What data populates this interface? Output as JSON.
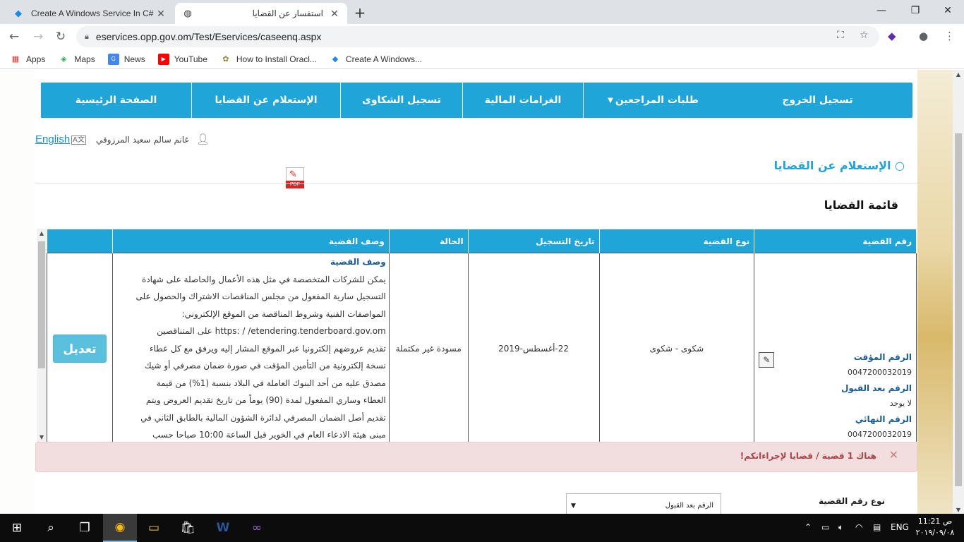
{
  "browser": {
    "tabs": [
      {
        "title": "Create A Windows Service In C#",
        "icon": "windows-service-icon",
        "active": false
      },
      {
        "title": "استفسار عن القضايا",
        "icon": "globe-icon",
        "active": true
      }
    ],
    "url": "eservices.opp.gov.om/Test/Eservices/caseenq.aspx",
    "bookmarks": [
      {
        "label": "Apps",
        "icon": "apps-grid-icon"
      },
      {
        "label": "Maps",
        "icon": "maps-pin-icon"
      },
      {
        "label": "News",
        "icon": "news-icon"
      },
      {
        "label": "YouTube",
        "icon": "youtube-icon"
      },
      {
        "label": "How to Install Oracl...",
        "icon": "oracle-icon"
      },
      {
        "label": "Create A Windows...",
        "icon": "windows-service-icon"
      }
    ]
  },
  "site": {
    "nav": [
      "الصفحة الرئيسية",
      "الإستعلام عن القضايا",
      "تسجيل الشكاوى",
      "الغرامات المالية",
      "طلبات المراجعين",
      "تسجيل الخروج"
    ],
    "lang_link": "English",
    "user_name": "غانم سالم سعيد المرزوقي",
    "section_title": "الإستعلام عن القضايا",
    "section_bullet": "○",
    "pdf_label": "PDF",
    "list_title": "قائمة القضايا",
    "table": {
      "headers": [
        "رقم القضية",
        "نوع القضية",
        "تاريخ التسجيل",
        "الحالة",
        "وصف القضية",
        ""
      ],
      "row": {
        "temp_no_label": "الرقم المؤقت",
        "temp_no": "0047200032019",
        "accepted_no_label": "الرقم بعد القبول",
        "accepted_no": "لا يوجد",
        "final_no_label": "الرقم النهائي",
        "final_no": "0047200032019",
        "case_type": "شكوى - شكوى",
        "reg_date": "22-أغسطس-2019",
        "status": "مسودة غير مكتملة",
        "desc_heading": "وصف القضية",
        "desc_lines": [
          "يمكن للشركات المتخصصة في مثل هذه الأعمال والحاصلة على شهادة",
          "التسجيل سارية المفعول من مجلس المناقصات الاشتراك والحصول على",
          "المواصفات الفنية وشروط المناقصة من الموقع الإلكتروني:",
          "https: / /etendering.tenderboard.gov.om على المتناقصين",
          "تقديم عروضهم إلكترونيا عبر الموقع المشار إليه ويرفق مع كل عطاء",
          "نسخة إلكترونية من التأمين المؤقت في صورة ضمان مصرفي أو شيك",
          "مصدق عليه من أحد البنوك العاملة في البلاد بنسبة (1%) من قيمة",
          "العطاء وساري المفعول لمدة (90) يوماً من تاريخ تقديم العروض ويتم",
          "تقديم أصل الضمان المصرفي لدائرة الشؤون المالية بالطابق الثاني في",
          "مبنى هيئة الادعاء العام في الخوير قبل الساعة 10:00 صباحا حسب"
        ],
        "edit_label": "تعديل"
      }
    },
    "alert": "هناك 1 قضية / قضايا لإجراءاتكم!",
    "case_type_label": "نوع رقم القضية",
    "case_select_value": "الرقم بعد القبول"
  },
  "taskbar": {
    "lang": "ENG",
    "time": "11:21 ص",
    "date": "٢٠١٩/٠٩/٠٨"
  }
}
